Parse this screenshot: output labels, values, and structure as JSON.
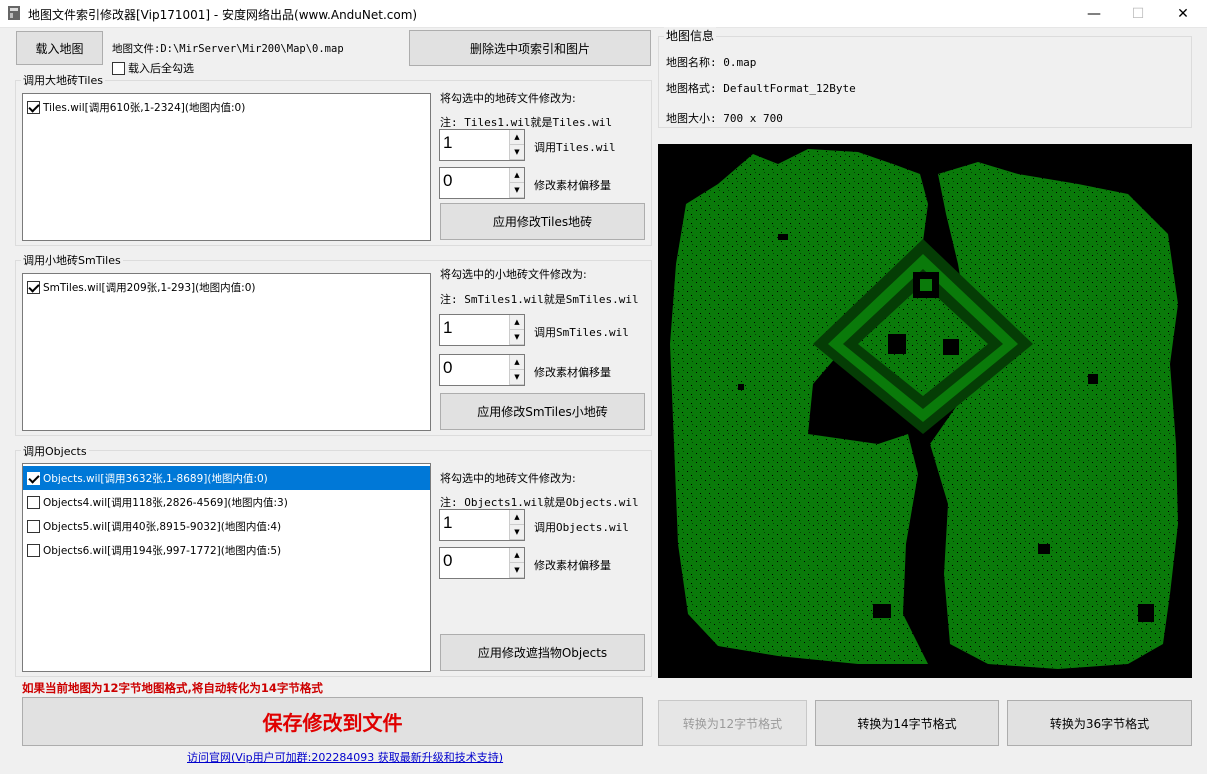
{
  "window": {
    "title": "地图文件索引修改器[Vip171001] - 安度网络出品(www.AnduNet.com)",
    "minimize": "—",
    "maximize": "☐",
    "close": "✕"
  },
  "toolbar": {
    "load_map": "载入地图",
    "map_file_label": "地图文件:D:\\MirServer\\Mir200\\Map\\0.map",
    "select_all_after_load": "载入后全勾选",
    "delete_selected": "删除选中项索引和图片"
  },
  "tiles": {
    "group_title": "调用大地砖Tiles",
    "items": [
      {
        "label": "Tiles.wil[调用610张,1-2324](地图内值:0)",
        "checked": true
      }
    ],
    "change_to": "将勾选中的地砖文件修改为:",
    "note": "注: Tiles1.wil就是Tiles.wil",
    "index_value": "1",
    "index_label": "调用Tiles.wil",
    "offset_value": "0",
    "offset_label": "修改素材偏移量",
    "apply": "应用修改Tiles地砖"
  },
  "smtiles": {
    "group_title": "调用小地砖SmTiles",
    "items": [
      {
        "label": "SmTiles.wil[调用209张,1-293](地图内值:0)",
        "checked": true
      }
    ],
    "change_to": "将勾选中的小地砖文件修改为:",
    "note": "注: SmTiles1.wil就是SmTiles.wil",
    "index_value": "1",
    "index_label": "调用SmTiles.wil",
    "offset_value": "0",
    "offset_label": "修改素材偏移量",
    "apply": "应用修改SmTiles小地砖"
  },
  "objects": {
    "group_title": "调用Objects",
    "items": [
      {
        "label": "Objects.wil[调用3632张,1-8689](地图内值:0)",
        "checked": true,
        "selected": true
      },
      {
        "label": "Objects4.wil[调用118张,2826-4569](地图内值:3)",
        "checked": false
      },
      {
        "label": "Objects5.wil[调用40张,8915-9032](地图内值:4)",
        "checked": false
      },
      {
        "label": "Objects6.wil[调用194张,997-1772](地图内值:5)",
        "checked": false
      }
    ],
    "change_to": "将勾选中的地砖文件修改为:",
    "note": "注: Objects1.wil就是Objects.wil",
    "index_value": "1",
    "index_label": "调用Objects.wil",
    "offset_value": "0",
    "offset_label": "修改素材偏移量",
    "apply": "应用修改遮挡物Objects"
  },
  "warning": "如果当前地图为12字节地图格式,将自动转化为14字节格式",
  "save": "保存修改到文件",
  "website_link": "访问官网(Vip用户可加群:202284093 获取最新升级和技术支持)",
  "map_info": {
    "group_title": "地图信息",
    "name": "地图名称: 0.map",
    "format": "地图格式: DefaultFormat_12Byte",
    "size": "地图大小: 700 x 700"
  },
  "convert": {
    "to12": "转换为12字节格式",
    "to14": "转换为14字节格式",
    "to36": "转换为36字节格式"
  },
  "colors": {
    "map_green": "#0a7a0a",
    "warning_red": "#cc0000",
    "save_red": "#e00000",
    "selection_blue": "#0078d7"
  },
  "icons": {
    "app": "app-icon",
    "up": "arrow-up-icon",
    "down": "arrow-down-icon"
  }
}
